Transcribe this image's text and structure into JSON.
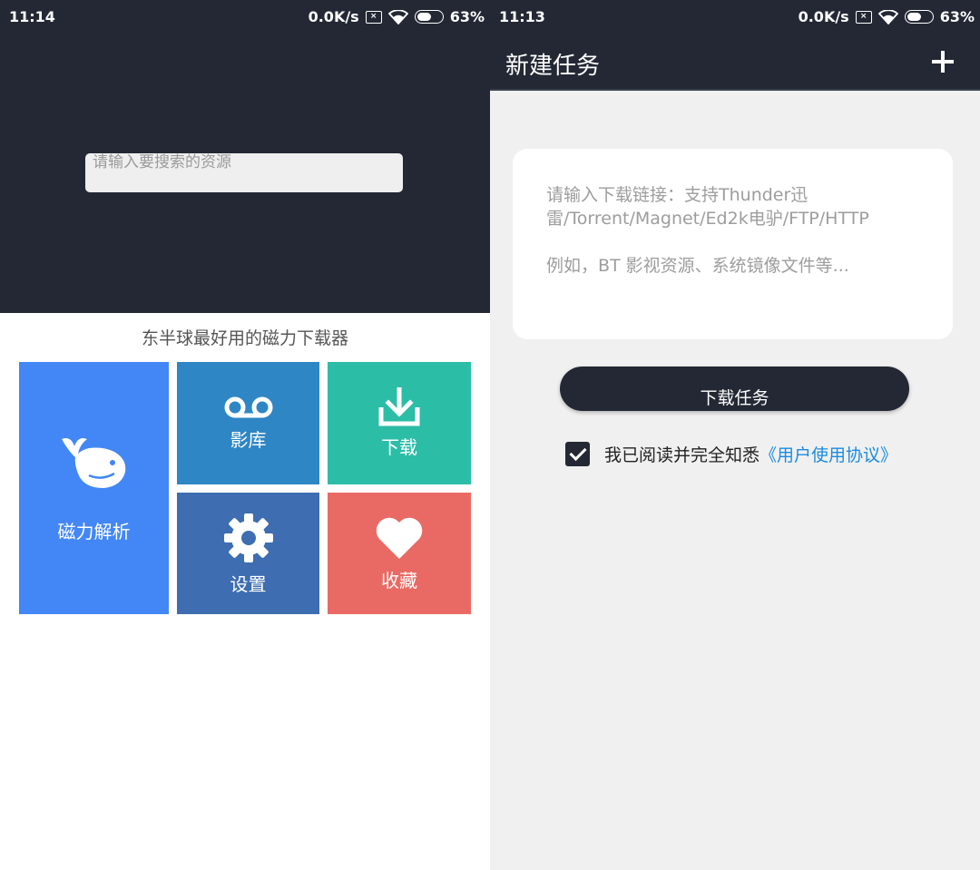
{
  "left": {
    "status": {
      "time": "11:14",
      "speed": "0.0K/s",
      "battery": "63%",
      "battery_level": 0.63
    },
    "search": {
      "placeholder": "请输入要搜索的资源"
    },
    "slogan": "东半球最好用的磁力下载器",
    "tiles": {
      "magnet": {
        "label": "磁力解析",
        "icon": "whale-icon",
        "color": "#4287f5"
      },
      "video": {
        "label": "影库",
        "icon": "voicemail-icon",
        "color": "#2f86c5"
      },
      "download": {
        "label": "下载",
        "icon": "download-icon",
        "color": "#2cbda7"
      },
      "settings": {
        "label": "设置",
        "icon": "gear-icon",
        "color": "#3e6db1"
      },
      "favorites": {
        "label": "收藏",
        "icon": "heart-icon",
        "color": "#e96a64"
      }
    }
  },
  "right": {
    "status": {
      "time": "11:13",
      "speed": "0.0K/s",
      "battery": "63%",
      "battery_level": 0.63
    },
    "appbar": {
      "title": "新建任务",
      "add_icon": "plus-icon"
    },
    "link_input": {
      "placeholder": "请输入下载链接：支持Thunder迅雷/Torrent/Magnet/Ed2k电驴/FTP/HTTP\n\n例如，BT 影视资源、系统镜像文件等..."
    },
    "download_button": "下载任务",
    "agreement": {
      "checked": true,
      "text": "我已阅读并完全知悉",
      "link": "《用户使用协议》"
    }
  },
  "colors": {
    "dark": "#232834",
    "link": "#1a8be0"
  }
}
